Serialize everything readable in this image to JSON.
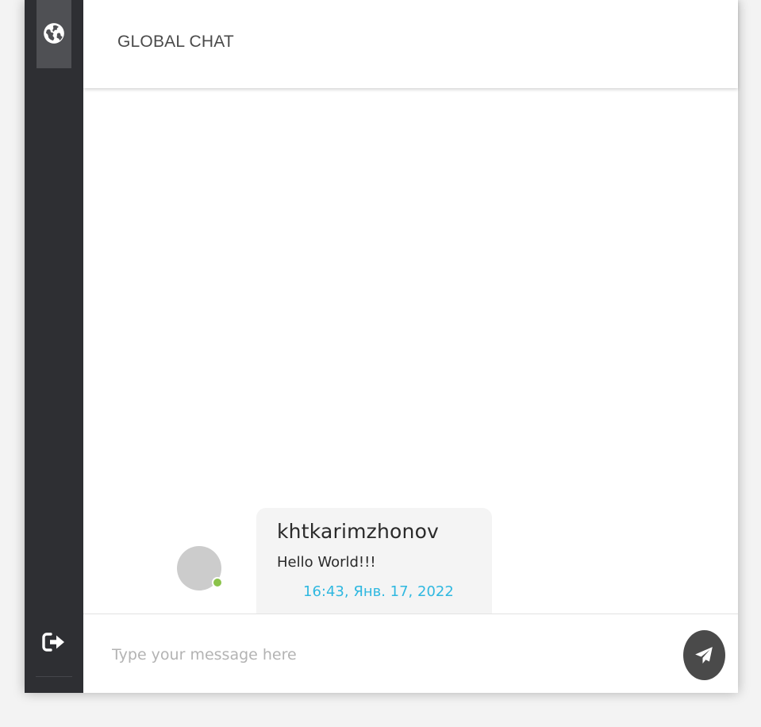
{
  "colors": {
    "sidebar_bg": "#2e2f33",
    "sidebar_active_bg": "#4f5054",
    "online_status": "#8bc34a",
    "timestamp": "#2fb8e0",
    "send_button_bg": "#4a4a4a",
    "bubble_bg": "#f4f4f4"
  },
  "sidebar": {
    "items": [
      {
        "icon": "globe-icon",
        "active": true
      },
      {
        "icon": "sign-out-icon",
        "active": false
      }
    ]
  },
  "header": {
    "title": "GLOBAL CHAT"
  },
  "messages": [
    {
      "author": "khtkarimzhonov",
      "text": "Hello World!!!",
      "time": "16:43, Янв. 17, 2022",
      "online": true
    }
  ],
  "composer": {
    "placeholder": "Type your message here",
    "value": "",
    "send_icon": "paper-plane-icon"
  }
}
